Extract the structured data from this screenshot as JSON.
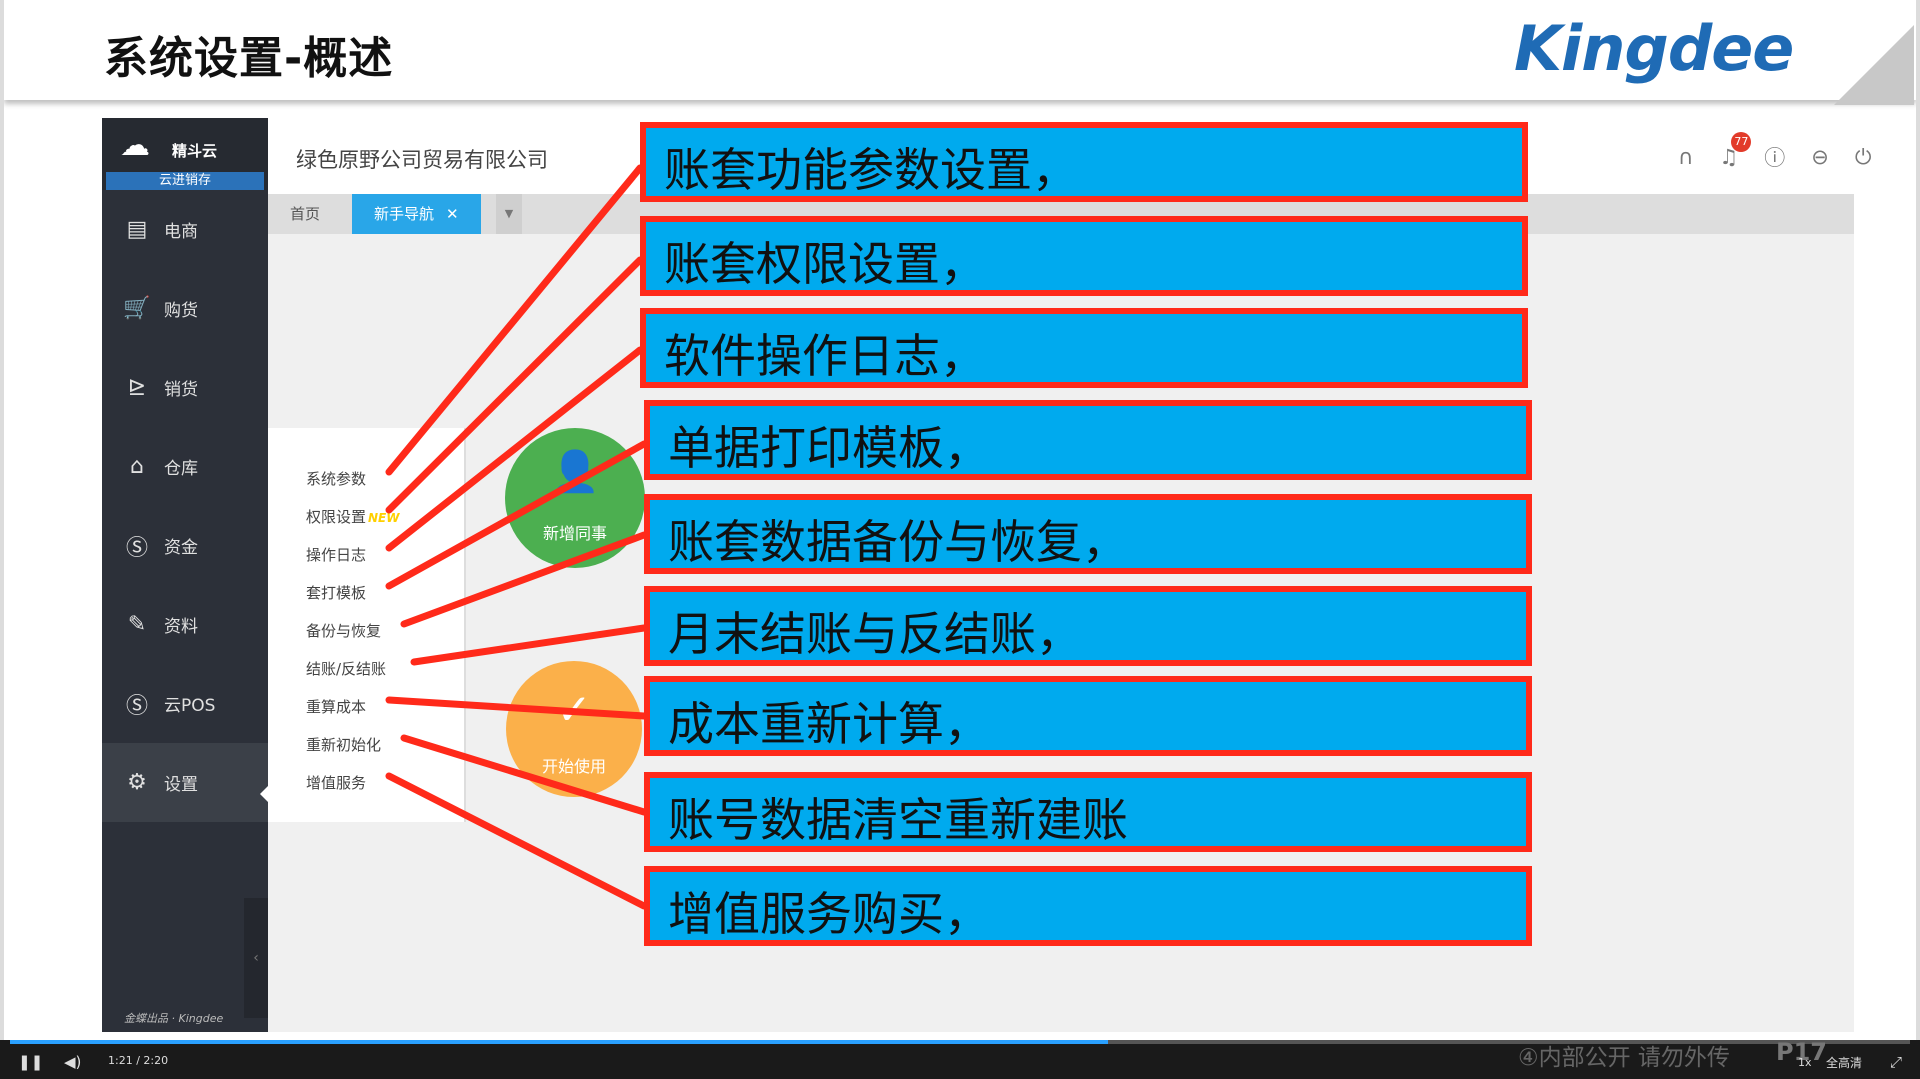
{
  "slide": {
    "title": "系统设置-概述",
    "logo": "Kingdee"
  },
  "app": {
    "brand": "精斗云",
    "subbrand": "云进销存",
    "company": "绿色原野公司贸易有限公司",
    "notification_count": "77",
    "footer": "金蝶出品 · Kingdee",
    "nav": [
      {
        "label": "电商",
        "icon": "store-icon"
      },
      {
        "label": "购货",
        "icon": "cart-icon"
      },
      {
        "label": "销货",
        "icon": "cart-out-icon"
      },
      {
        "label": "仓库",
        "icon": "warehouse-icon"
      },
      {
        "label": "资金",
        "icon": "dollar-icon"
      },
      {
        "label": "资料",
        "icon": "pencil-icon"
      },
      {
        "label": "云POS",
        "icon": "dollar-icon"
      },
      {
        "label": "设置",
        "icon": "gear-icon"
      }
    ],
    "tabs": {
      "home": "首页",
      "current": "新手导航"
    },
    "submenu": [
      "系统参数",
      "权限设置",
      "操作日志",
      "套打模板",
      "备份与恢复",
      "结账/反结账",
      "重算成本",
      "重新初始化",
      "增值服务"
    ],
    "new_tag": "NEW",
    "circle_add": "新增同事",
    "circle_start": "开始使用"
  },
  "callouts": [
    "账套功能参数设置，",
    "账套权限设置，",
    "软件操作日志，",
    "单据打印模板，",
    "账套数据备份与恢复，",
    "月末结账与反结账，",
    "成本重新计算，",
    "账号数据清空重新建账",
    "增值服务购买，"
  ],
  "player": {
    "time": "1:21 / 2:20",
    "progress": 0.578,
    "watermark": "④内部公开 请勿外传",
    "page": "P17",
    "quality": "全高清",
    "speed": "1x"
  },
  "colors": {
    "callout_bg": "#00aaee",
    "callout_border": "#ff2a1a",
    "tab_active": "#29a6e8"
  }
}
